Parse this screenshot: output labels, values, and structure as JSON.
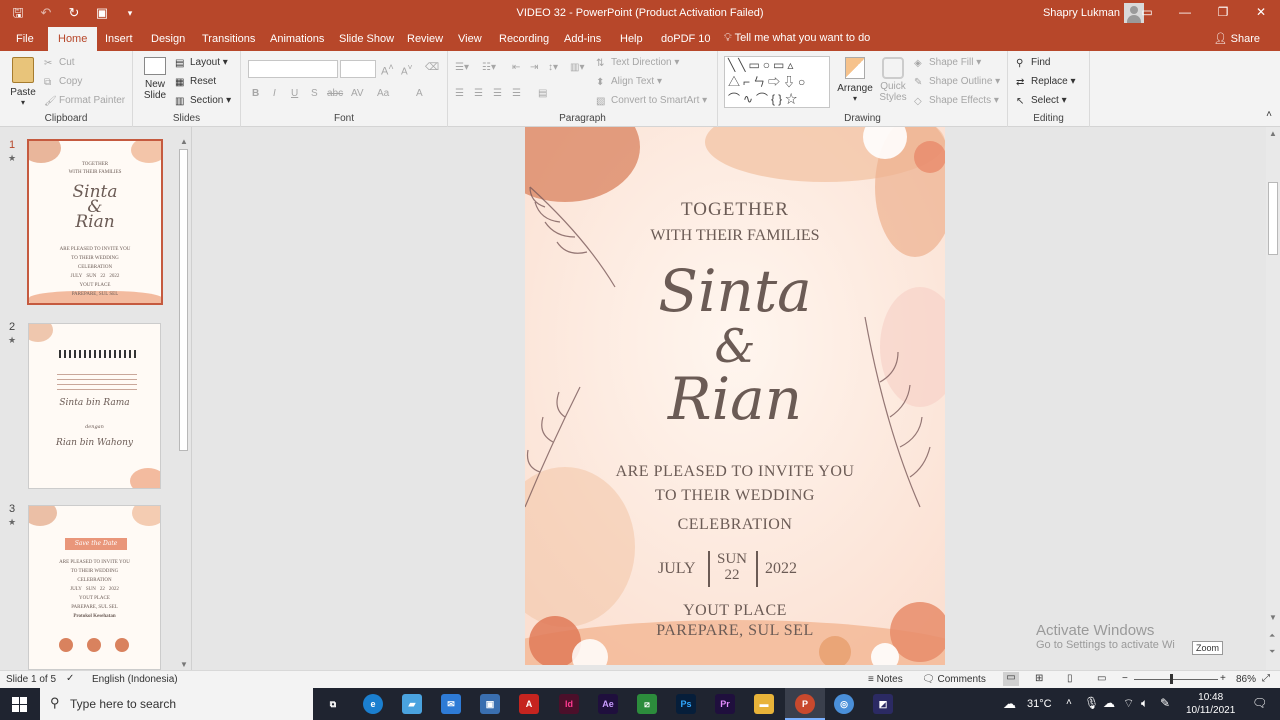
{
  "app": {
    "title": "VIDEO 32  -  PowerPoint (Product Activation Failed)",
    "user": "Shapry Lukman",
    "accent": "#b7472a"
  },
  "tabs": [
    "File",
    "Home",
    "Insert",
    "Design",
    "Transitions",
    "Animations",
    "Slide Show",
    "Review",
    "View",
    "Recording",
    "Add-ins",
    "Help",
    "doPDF 10"
  ],
  "active_tab": "Home",
  "tell_me": "Tell me what you want to do",
  "share": "Share",
  "ribbon": {
    "clipboard": {
      "paste": "Paste",
      "cut": "Cut",
      "copy": "Copy",
      "format_painter": "Format Painter",
      "label": "Clipboard"
    },
    "slides": {
      "new_slide": "New Slide",
      "layout": "Layout",
      "reset": "Reset",
      "section": "Section",
      "label": "Slides"
    },
    "font": {
      "label": "Font",
      "bold": "B",
      "italic": "I",
      "underline": "U",
      "shadow": "S",
      "strike": "abc",
      "spacing": "AV",
      "case": "Aa",
      "color": "A"
    },
    "paragraph": {
      "label": "Paragraph",
      "text_direction": "Text Direction",
      "align_text": "Align Text",
      "smartart": "Convert to SmartArt"
    },
    "drawing": {
      "label": "Drawing",
      "arrange": "Arrange",
      "quick_styles": "Quick Styles",
      "shape_fill": "Shape Fill",
      "shape_outline": "Shape Outline",
      "shape_effects": "Shape Effects"
    },
    "editing": {
      "label": "Editing",
      "find": "Find",
      "replace": "Replace",
      "select": "Select"
    }
  },
  "thumbnails": [
    {
      "num": "1",
      "lines": [
        "TOGETHER",
        "WITH THEIR FAMILIES",
        "Sinta",
        "&",
        "Rian",
        "ARE PLEASED TO INVITE YOU",
        "TO THEIR WEDDING",
        "CELEBRATION",
        "JULY",
        "SUN",
        "22",
        "2022",
        "YOUT PLACE",
        "PAREPARE, SUL SEL"
      ]
    },
    {
      "num": "2",
      "lines": [
        "Sinta bin Rama",
        "dengan",
        "Rian bin Wahony"
      ]
    },
    {
      "num": "3",
      "lines": [
        "Save the Date",
        "ARE PLEASED TO INVITE YOU",
        "TO THEIR WEDDING",
        "CELEBRATION",
        "JULY",
        "SUN",
        "22",
        "2022",
        "YOUT PLACE",
        "PAREPARE, SUL SEL",
        "Protokol Kesehatan"
      ]
    }
  ],
  "slide": {
    "line1": "TOGETHER",
    "line2": "WITH THEIR FAMILIES",
    "name1": "Sinta",
    "amp": "&",
    "name2": "Rian",
    "invite1": "ARE PLEASED TO INVITE YOU",
    "invite2": "TO THEIR WEDDING",
    "invite3": "CELEBRATION",
    "month": "JULY",
    "day_name": "SUN",
    "day": "22",
    "year": "2022",
    "place1": "YOUT PLACE",
    "place2": "PAREPARE, SUL SEL"
  },
  "activate": {
    "title": "Activate Windows",
    "sub": "Go to Settings to activate Wi",
    "zoom_tip": "Zoom"
  },
  "status": {
    "slide": "Slide 1 of 5",
    "lang": "English (Indonesia)",
    "notes": "Notes",
    "comments": "Comments",
    "zoom": "86%"
  },
  "taskbar": {
    "search": "Type here to search",
    "temp": "31°C",
    "time": "10:48",
    "date": "10/11/2021"
  }
}
